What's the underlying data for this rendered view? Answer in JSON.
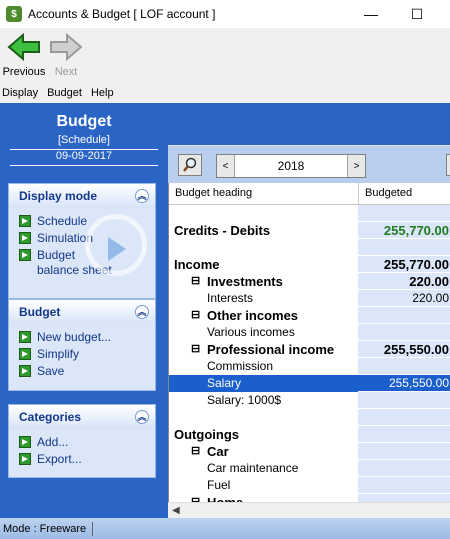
{
  "window": {
    "title": "Accounts & Budget [ LOF account ]",
    "minimize_glyph": "—",
    "maximize_glyph": "☐"
  },
  "toolbar": {
    "previous_label": "Previous",
    "next_label": "Next"
  },
  "menu": [
    "Display",
    "Budget",
    "Help"
  ],
  "left": {
    "title": "Budget",
    "schedule_label": "[Schedule]",
    "date": "09-09-2017",
    "display_mode": {
      "title": "Display mode",
      "items": [
        "Schedule",
        "Simulation",
        "Budget balance sheet"
      ]
    },
    "budget": {
      "title": "Budget",
      "items": [
        "New budget...",
        "Simplify",
        "Save"
      ]
    },
    "categories": {
      "title": "Categories",
      "items": [
        "Add...",
        "Export..."
      ]
    }
  },
  "year_selector": {
    "year": "2018",
    "prev_glyph": "<",
    "next_glyph": ">"
  },
  "grid": {
    "col_heading": "Budget heading",
    "col_budgeted": "Budgeted",
    "rows": [
      {
        "name": "",
        "value": "",
        "level": "blank"
      },
      {
        "name": "Credits - Debits",
        "value": "255,770.00",
        "level": "lvl0",
        "green": true
      },
      {
        "name": "",
        "value": "",
        "level": "blank"
      },
      {
        "name": "Income",
        "value": "255,770.00",
        "level": "lvl0"
      },
      {
        "name": "Investments",
        "value": "220.00",
        "level": "lvl1",
        "expander": "⊟"
      },
      {
        "name": "Interests",
        "value": "220.00",
        "level": "lvl2"
      },
      {
        "name": "Other incomes",
        "value": "",
        "level": "lvl1",
        "expander": "⊟"
      },
      {
        "name": "Various incomes",
        "value": "",
        "level": "lvl2"
      },
      {
        "name": "Professional income",
        "value": "255,550.00",
        "level": "lvl1",
        "expander": "⊟"
      },
      {
        "name": "Commission",
        "value": "",
        "level": "lvl2"
      },
      {
        "name": "Salary",
        "value": "255,550.00",
        "level": "lvl2",
        "selected": true
      },
      {
        "name": "Salary: 1000$",
        "value": "",
        "level": "lvl2"
      },
      {
        "name": "",
        "value": "",
        "level": "blank"
      },
      {
        "name": "Outgoings",
        "value": "",
        "level": "lvl0"
      },
      {
        "name": "Car",
        "value": "",
        "level": "lvl1",
        "expander": "⊟"
      },
      {
        "name": "Car maintenance",
        "value": "",
        "level": "lvl2"
      },
      {
        "name": "Fuel",
        "value": "",
        "level": "lvl2"
      },
      {
        "name": "Home",
        "value": "",
        "level": "lvl1",
        "expander": "⊟"
      }
    ]
  },
  "status": {
    "mode": "Mode : Freeware"
  },
  "colors": {
    "panel_blue": "#2a64c5",
    "selection": "#1a5fcc",
    "positive_green": "#1f7a1f"
  }
}
